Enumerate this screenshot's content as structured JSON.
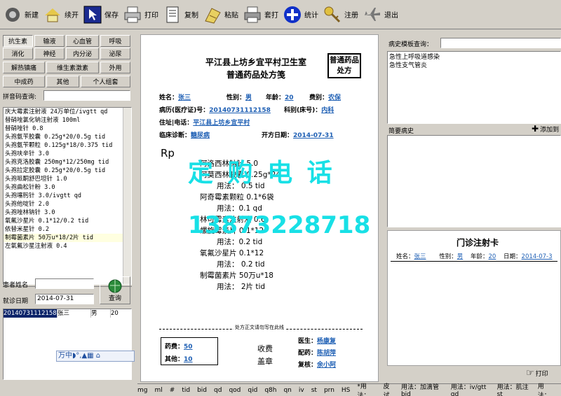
{
  "toolbar": {
    "items": [
      "新建",
      "续开",
      "保存",
      "打印",
      "复制",
      "粘贴",
      "套打",
      "统计",
      "注册",
      "退出"
    ]
  },
  "left": {
    "categories": {
      "row1": [
        "抗生素",
        "输液",
        "心血管",
        "呼吸"
      ],
      "row2": [
        "消化",
        "神经",
        "内分泌",
        "泌尿"
      ],
      "row3": [
        "解热镇痛",
        "维生素激素",
        "外用"
      ],
      "row4": [
        "中成药",
        "其他",
        "个人组套"
      ]
    },
    "pinyin_label": "拼音码查询:",
    "drugs": [
      "庆大霉素注射液  24万单位/ivgtt qd",
      "替硝唑氯化钠注射液  100ml",
      "替硝唑针 0.8",
      "头孢氨苄胶囊 0.25g*20/0.5g tid",
      "头孢氨苄颗粒 0.125g*18/0.375 tid",
      "头孢呋辛针  3.0",
      "头孢克洛胶囊 250mg*12/250mg tid",
      "头孢拉定胶囊 0.25g*20/0.5g tid",
      "头孢哌酮舒巴坦针  1.0",
      "头孢曲松针粉  3.0",
      "头孢噻肟针  3.0/ivgtt qd",
      "头孢他啶针 2.0",
      "头孢唑林钠针  3.0",
      "氧氟沙星片 0.1*12/0.2 tid",
      "依替米星针 0.2",
      "制霉菌素片  50万u*18/2片 tid",
      "左氧氟沙星注射液  0.4"
    ],
    "patient_name_label": "患者姓名",
    "visit_date_label": "就诊日期",
    "visit_date_value": "2014-07-31",
    "query_button": "查询",
    "records": [
      {
        "id": "20140731112158",
        "name": "张三",
        "gender": "男",
        "age": "20"
      }
    ],
    "ime": "万中◗°,▲▦ ⌂"
  },
  "rx": {
    "clinic": "平江县上坊乡宜平村卫生室",
    "title": "普通药品处方笺",
    "stamp": "普通药品处方",
    "name_label": "姓名：",
    "name": "张三",
    "gender_label": "性别：",
    "gender": "男",
    "age_label": "年龄：",
    "age": "20",
    "fee_type_label": "费别：",
    "fee_type": "农保",
    "record_label": "病历(医疗证)号：",
    "record": "20140731112158",
    "dept_label": "科别(床号)：",
    "dept": "内科",
    "address_label": "住址|电话：",
    "address": "平江县上坊乡宜平村",
    "diagnosis_label": "临床诊断：",
    "diagnosis": "糖尿病",
    "date_label": "开方日期：",
    "date": "2014-07-31",
    "rp": "Rp",
    "lines": [
      "阿洛西林钠针 5.0",
      "阿莫西林胶囊  0.25g*24",
      "用法：  0.5  tid",
      "阿奇霉素颗粒  0.1*6袋",
      "用法：0.1  qd",
      "林可霉素注射液  0.6",
      "螺旋霉素片  0.1*12",
      "用法：0.2  tid",
      "氧氟沙星片 0.1*12",
      "用法：  0.2 tid",
      "制霉菌素片   50万u*18",
      "用法：  2片  tid"
    ],
    "divider": "处方正文请勿写在此线",
    "drug_fee_label": "药费：",
    "drug_fee": "50",
    "other_fee_label": "其他：",
    "other_fee": "10",
    "collect_label": "收费",
    "seal_label": "盖章",
    "doctor_label": "医生：",
    "doctor": "杨康复",
    "dispense_label": "配药：",
    "dispense": "陈胡萍",
    "check_label": "复核：",
    "check": "余小阿"
  },
  "watermark": {
    "line1": "定 购 电 话",
    "line2": "13873228718"
  },
  "right": {
    "template_label": "病史模板查询：",
    "templates": [
      "急性上呼吸道感染",
      "急性支气管炎"
    ],
    "history_label": "简要病史",
    "add_label": "添加到",
    "card_title": "门诊注射卡",
    "card_name_label": "姓名：",
    "card_name": "张三",
    "card_gender_label": "性别：",
    "card_gender": "男",
    "card_age_label": "年龄：",
    "card_age": "20",
    "card_date_label": "日期：",
    "card_date": "2014-07-3",
    "print_label": "打印"
  },
  "bottom": {
    "items": [
      "mg",
      "ml",
      "#",
      "tid",
      "bid",
      "qd",
      "qod",
      "qid",
      "q8h",
      "qn",
      "iv",
      "st",
      "prn",
      "HS",
      "*用法：",
      "皮试",
      "用法：加滴管 bid",
      "用法：iv/gtt qd",
      "用法：肌注 st",
      "用法："
    ]
  },
  "colors": {
    "field": "#1e5fb4",
    "watermark": "#18e0e6"
  }
}
